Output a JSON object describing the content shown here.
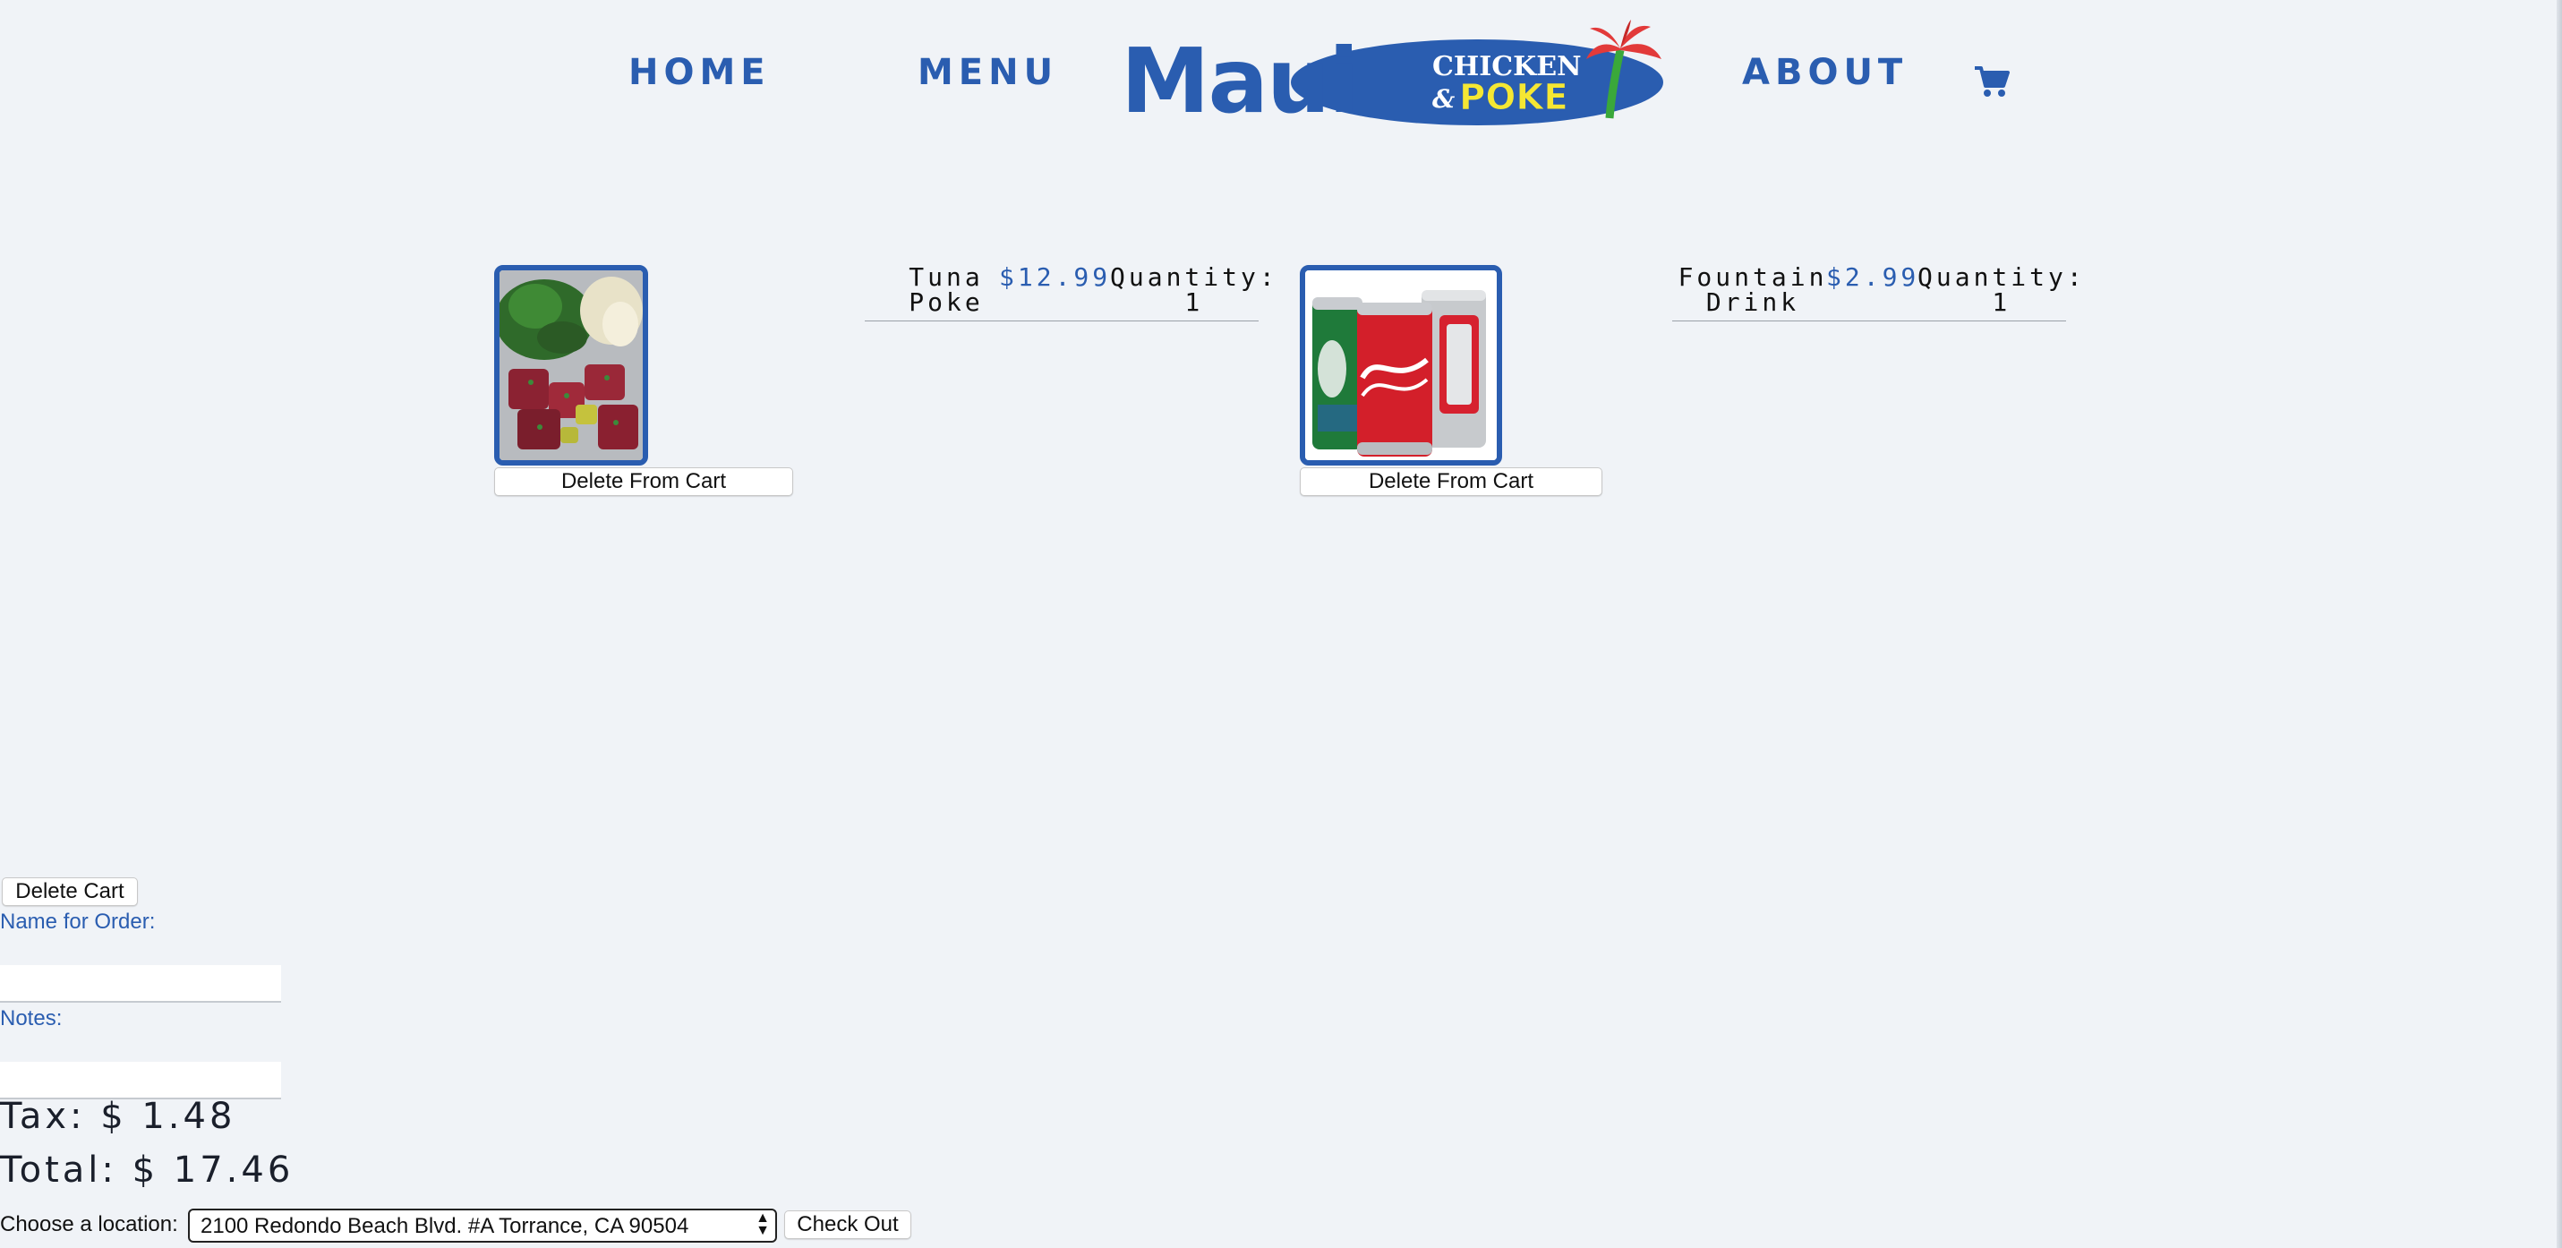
{
  "nav": {
    "home": "HOME",
    "menu": "MENU",
    "about": "ABOUT",
    "cart_icon": "shopping-cart-icon"
  },
  "logo": {
    "word": "Maui",
    "line1": "CHICKEN",
    "amp": "&",
    "line2": "POKE",
    "icon": "palm-tree-icon"
  },
  "cart": {
    "items": [
      {
        "name_line1": "Tuna",
        "name_line2": "Poke",
        "price": "$12.99",
        "quantity_label": "Quantity:",
        "quantity": "1",
        "delete_label": "Delete From Cart"
      },
      {
        "name_line1": "Fountain",
        "name_line2": "Drink",
        "price": "$2.99",
        "quantity_label": "Quantity:",
        "quantity": "1",
        "delete_label": "Delete From Cart"
      }
    ]
  },
  "form": {
    "delete_cart_label": "Delete Cart",
    "name_label": "Name for Order:",
    "name_value": "",
    "notes_label": "Notes:",
    "notes_value": "",
    "tax_text": "Tax: $ 1.48",
    "total_text": "Total: $ 17.46",
    "location_label": "Choose a location:",
    "location_selected": "2100 Redondo Beach Blvd. #A Torrance, CA 90504",
    "checkout_label": "Check Out"
  },
  "colors": {
    "brand_blue": "#2a5db0",
    "brand_yellow": "#f5e733",
    "palm_red": "#e23a3a",
    "palm_green": "#3aa83a",
    "background": "#f0f3f7"
  }
}
